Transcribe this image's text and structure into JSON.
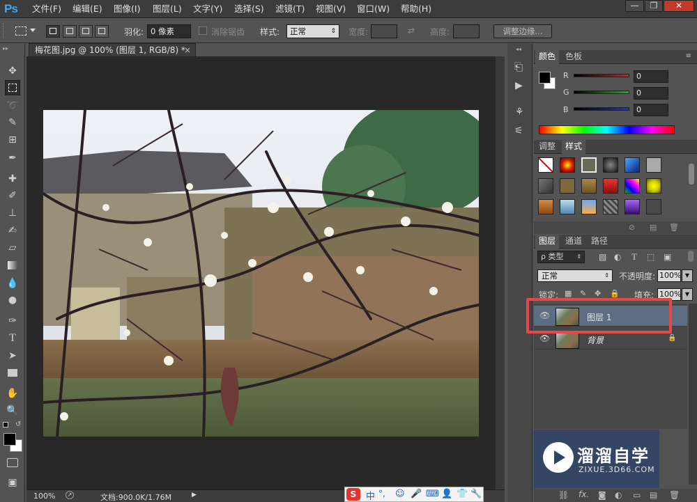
{
  "app": {
    "logo": "Ps"
  },
  "menu": [
    {
      "label": "文件(F)"
    },
    {
      "label": "编辑(E)"
    },
    {
      "label": "图像(I)"
    },
    {
      "label": "图层(L)"
    },
    {
      "label": "文字(Y)"
    },
    {
      "label": "选择(S)"
    },
    {
      "label": "滤镜(T)"
    },
    {
      "label": "视图(V)"
    },
    {
      "label": "窗口(W)"
    },
    {
      "label": "帮助(H)"
    }
  ],
  "window_controls": {
    "minimize": "—",
    "restore": "❐",
    "close": "✕"
  },
  "options": {
    "feather_label": "羽化:",
    "feather_value": "0 像素",
    "antialias_label": "消除锯齿",
    "style_label": "样式:",
    "style_value": "正常",
    "width_label": "宽度:",
    "height_label": "高度:",
    "refine_edge": "调整边缘..."
  },
  "document": {
    "tab_title": "梅花图.jpg @ 100% (图层 1, RGB/8) *",
    "close": "×"
  },
  "status": {
    "zoom": "100%",
    "doc_size": "文档:900.0K/1.76M"
  },
  "color_panel": {
    "tabs": [
      "颜色",
      "色板"
    ],
    "channels": [
      {
        "name": "R",
        "value": "0",
        "color": "#d42020"
      },
      {
        "name": "G",
        "value": "0",
        "color": "#20b020"
      },
      {
        "name": "B",
        "value": "0",
        "color": "#2030d8"
      }
    ]
  },
  "styles_panel": {
    "tabs": [
      "调整",
      "样式"
    ]
  },
  "layers_panel": {
    "tabs": [
      "图层",
      "通道",
      "路径"
    ],
    "filter_kind": "ρ 类型",
    "blend_mode": "正常",
    "opacity_label": "不透明度:",
    "opacity_value": "100%",
    "lock_label": "锁定:",
    "fill_label": "填充:",
    "fill_value": "100%",
    "layers": [
      {
        "name": "图层 1",
        "selected": true,
        "visible": true
      },
      {
        "name": "背景",
        "selected": false,
        "visible": true,
        "locked": true
      }
    ],
    "footer_fx": "fx."
  },
  "watermark": {
    "brand": "溜溜自学",
    "url": "ZIXUE.3D66.COM"
  },
  "ime": {
    "logo": "S",
    "lang": "中"
  },
  "highlight_color": "#e8474a"
}
